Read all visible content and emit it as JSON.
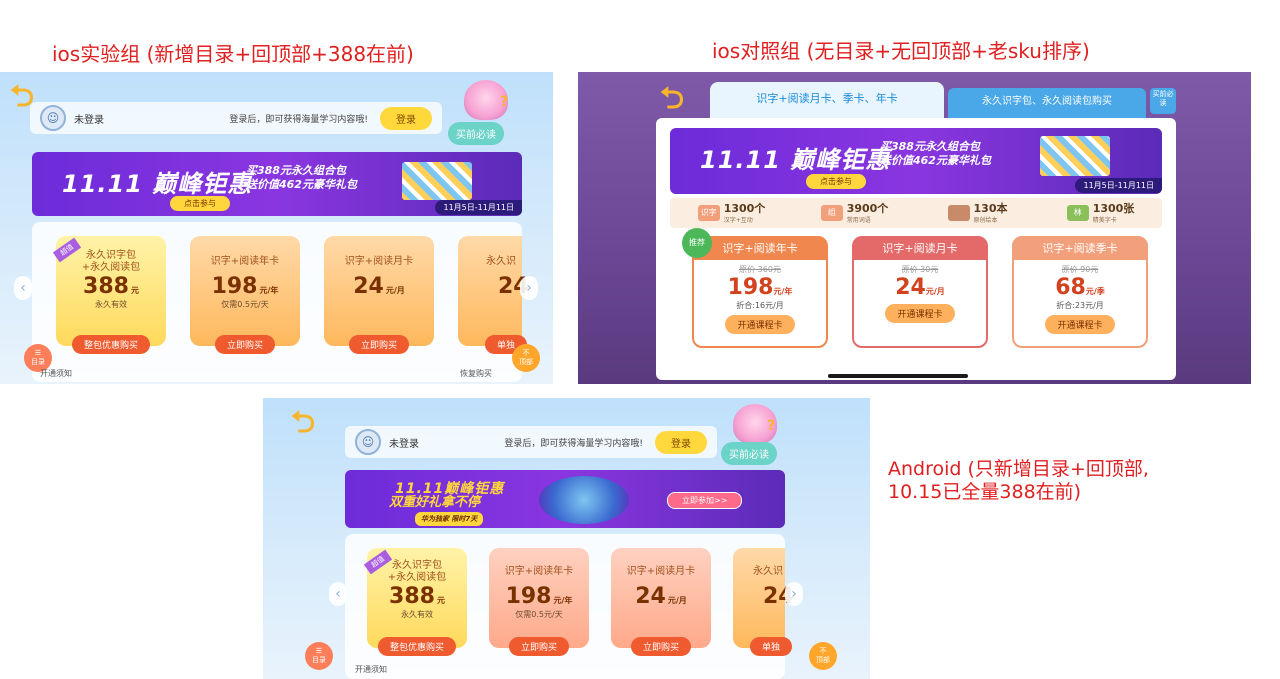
{
  "captions": {
    "ios_test": "ios实验组 (新增目录+回顶部+388在前)",
    "ios_control": "ios对照组 (无目录+无回顶部+老sku排序)",
    "android": "Android (只新增目录+回顶部,\n10.15已全量388在前)"
  },
  "ios_test": {
    "login": {
      "name": "未登录",
      "tip": "登录后，即可获得海量学习内容哦!",
      "button": "登录"
    },
    "must_read": "买前必读",
    "banner": {
      "title": "11.11 巅峰钜惠",
      "sub1": "买388元永久组合包",
      "sub2": "送价值462元豪华礼包",
      "cta": "点击参与",
      "date": "11月5日-11月11日"
    },
    "cards": [
      {
        "tag": "超值",
        "title1": "永久识字包",
        "title2": "+永久阅读包",
        "price": "388",
        "unit": "元",
        "note": "永久有效",
        "button": "整包优惠购买"
      },
      {
        "title1": "识字+阅读年卡",
        "title2": "",
        "price": "198",
        "unit": "元/年",
        "note": "仅需0.5元/天",
        "button": "立即购买"
      },
      {
        "title1": "识字+阅读月卡",
        "title2": "",
        "price": "24",
        "unit": "元/月",
        "note": "",
        "button": "立即购买"
      },
      {
        "title1": "永久识",
        "title2": "",
        "price": "24",
        "unit": "",
        "note": "",
        "button": "单独"
      }
    ],
    "menu_label": "目录",
    "top_label1": "不",
    "top_label2": "顶部",
    "footer_left": "开通须知",
    "footer_right": "恢复购买"
  },
  "ios_control": {
    "tabs": [
      "识字+阅读月卡、季卡、年卡",
      "永久识字包、永久阅读包购买"
    ],
    "tab_must": "买前必读",
    "banner": {
      "title": "11.11 巅峰钜惠",
      "sub1": "买388元永久组合包",
      "sub2": "送价值462元豪华礼包",
      "cta": "点击参与",
      "date": "11月5日-11月11日"
    },
    "stats": [
      {
        "icon": "识字",
        "value": "1300个",
        "desc": "汉字+互动"
      },
      {
        "icon": "组",
        "value": "3900个",
        "desc": "常用词语"
      },
      {
        "icon": "",
        "value": "130本",
        "desc": "原创绘本"
      },
      {
        "icon": "林",
        "value": "1300张",
        "desc": "精美字卡"
      }
    ],
    "skus": [
      {
        "head": "识字+阅读年卡",
        "orig": "原价 360元",
        "price": "198",
        "unit": "元/年",
        "per": "折合:16元/月",
        "button": "开通课程卡",
        "color": "#f0874e"
      },
      {
        "head": "识字+阅读月卡",
        "orig": "原价 30元",
        "price": "24",
        "unit": "元/月",
        "per": "",
        "button": "开通课程卡",
        "color": "#e46a6a"
      },
      {
        "head": "识字+阅读季卡",
        "orig": "原价 90元",
        "price": "68",
        "unit": "元/季",
        "per": "折合:23元/月",
        "button": "开通课程卡",
        "color": "#f2a07b"
      }
    ],
    "recommend_tag": "推荐"
  },
  "android": {
    "login": {
      "name": "未登录",
      "tip": "登录后，即可获得海量学习内容哦!",
      "button": "登录"
    },
    "must_read": "买前必读",
    "banner": {
      "title": "11.11巅峰钜惠",
      "sub1": "双重好礼拿不停",
      "sub2": "华为独家  限时7天",
      "cta": "立即参加>>"
    },
    "cards": [
      {
        "tag": "超值",
        "title1": "永久识字包",
        "title2": "+永久阅读包",
        "price": "388",
        "unit": "元",
        "note": "永久有效",
        "button": "整包优惠购买"
      },
      {
        "title1": "识字+阅读年卡",
        "title2": "",
        "price": "198",
        "unit": "元/年",
        "note": "仅需0.5元/天",
        "button": "立即购买"
      },
      {
        "title1": "识字+阅读月卡",
        "title2": "",
        "price": "24",
        "unit": "元/月",
        "note": "",
        "button": "立即购买"
      },
      {
        "title1": "永久识",
        "title2": "",
        "price": "24",
        "unit": "",
        "note": "",
        "button": "单独"
      }
    ],
    "menu_label": "目录",
    "top_label1": "不",
    "top_label2": "顶部",
    "footer_left": "开通须知"
  }
}
